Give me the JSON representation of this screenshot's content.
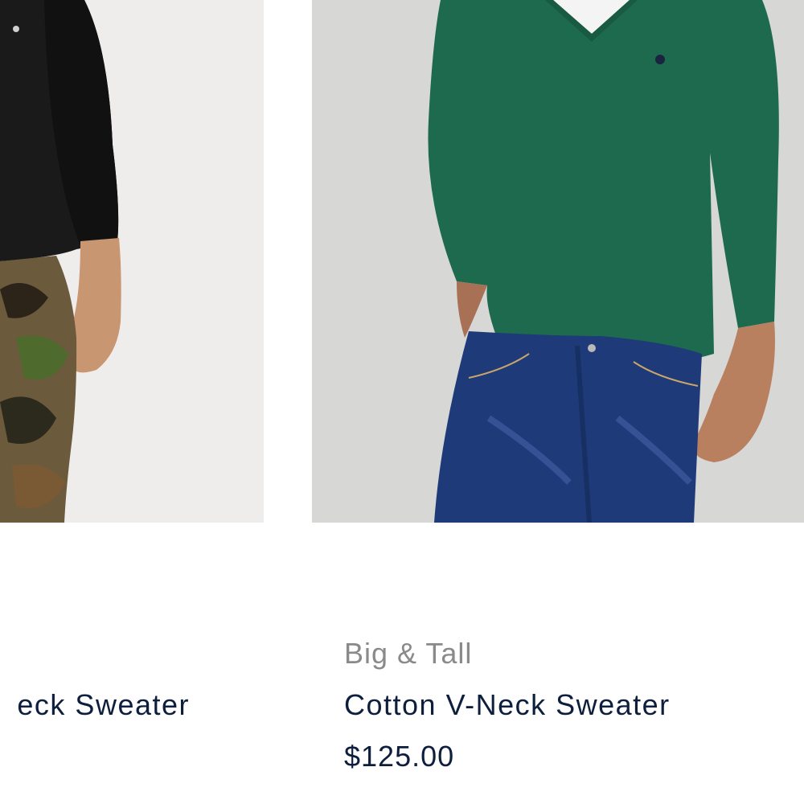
{
  "products": [
    {
      "id_label": "left",
      "brand": "",
      "name_visible": "eck Sweater",
      "price": ""
    },
    {
      "id_label": "right",
      "brand": "Big & Tall",
      "name": "Cotton V-Neck Sweater",
      "price": "$125.00"
    }
  ]
}
